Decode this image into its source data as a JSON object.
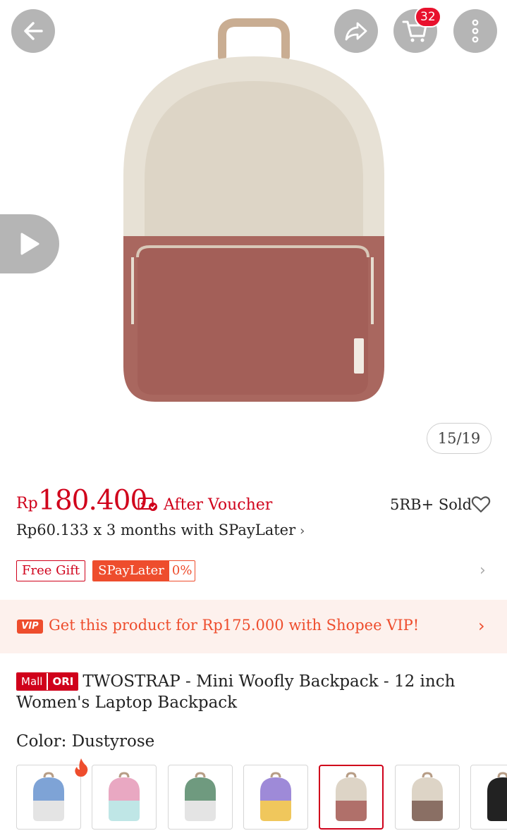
{
  "header": {
    "back": "back-arrow-icon",
    "share": "share-icon",
    "cart": "cart-icon",
    "cart_count": "32",
    "more": "more-vertical-icon"
  },
  "gallery": {
    "counter": "15/19",
    "video": "play-icon"
  },
  "price": {
    "currency": "Rp",
    "amount": "180.400",
    "voucher_label": "After Voucher",
    "sold": "5RB+ Sold",
    "installment": "Rp60.133 x 3 months with SPayLater",
    "installment_chevron": "›"
  },
  "tags": {
    "free_gift": "Free Gift",
    "spaylater": "SPayLater",
    "spaylater_rate": "0%",
    "chevron": "›"
  },
  "vip": {
    "badge": "VIP",
    "text": "Get this product for Rp175.000 with Shopee VIP!",
    "chevron": "›"
  },
  "product": {
    "badge_mall": "Mall",
    "badge_ori": "ORI",
    "title": "TWOSTRAP - Mini Woofly Backpack - 12 inch Women's Laptop Backpack"
  },
  "variation": {
    "label": "Color: Dustyrose",
    "selected_index": 4,
    "swatches": [
      {
        "top": "#7ea3d6",
        "bottom": "#e4e4e4"
      },
      {
        "top": "#e9a8c2",
        "bottom": "#bfe6e6"
      },
      {
        "top": "#6f9a7f",
        "bottom": "#e4e4e4"
      },
      {
        "top": "#9e8ad8",
        "bottom": "#f0c75c"
      },
      {
        "top": "#ddd4c6",
        "bottom": "#b0706a"
      },
      {
        "top": "#ddd4c6",
        "bottom": "#8a6f64"
      },
      {
        "top": "#222222",
        "bottom": "#222222"
      }
    ]
  },
  "colors": {
    "accent": "#d0011b",
    "orange": "#ee4d2d",
    "bag_top": "#e7e1d5",
    "bag_bottom": "#a9675f"
  }
}
